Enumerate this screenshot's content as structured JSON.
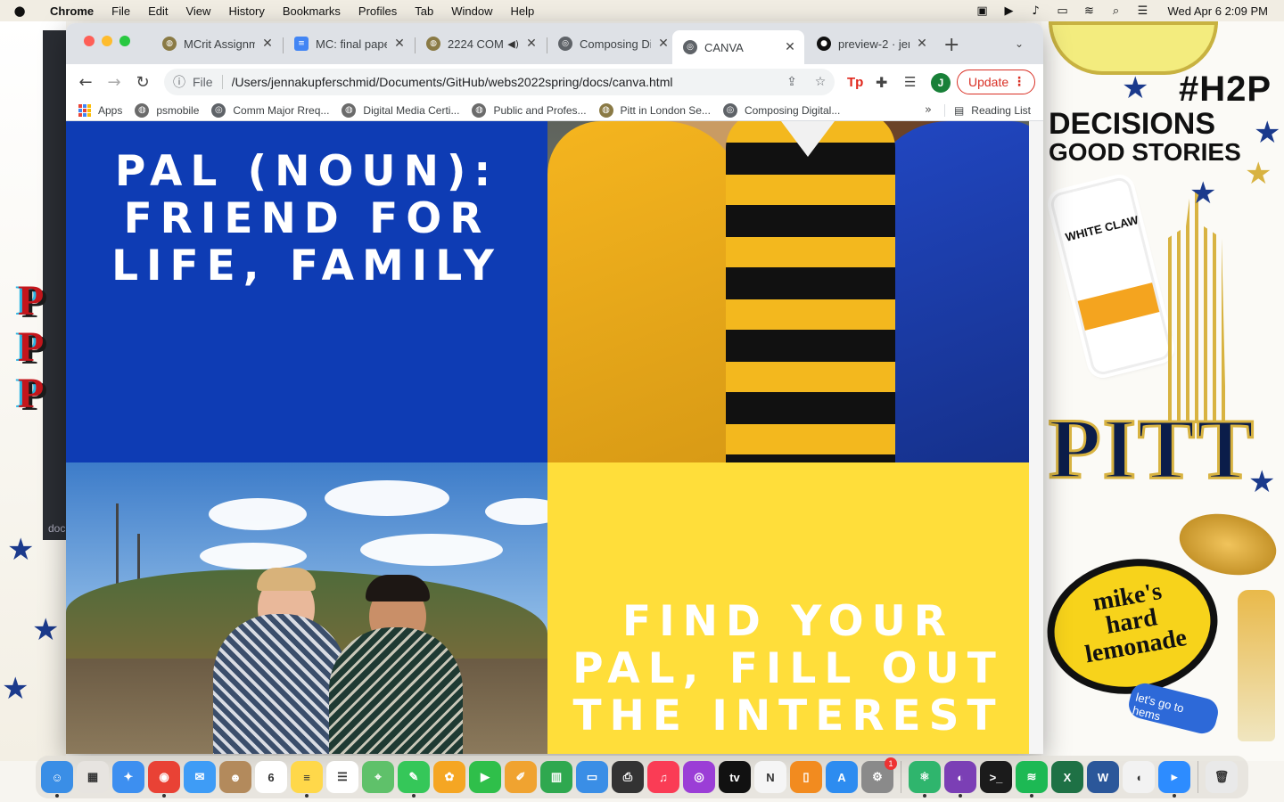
{
  "menubar": {
    "app_name": "Chrome",
    "items": [
      "File",
      "Edit",
      "View",
      "History",
      "Bookmarks",
      "Profiles",
      "Tab",
      "Window",
      "Help"
    ],
    "status_icons": [
      "facetime-icon",
      "play-icon",
      "sound-icon",
      "battery-icon",
      "wifi-icon",
      "spotlight-icon",
      "control-center-icon"
    ],
    "clock": "Wed Apr 6  2:09 PM"
  },
  "browser": {
    "tabs": [
      {
        "title": "MCrit Assignm",
        "favicon": "pitt-seal-icon",
        "color": "#8a7a45"
      },
      {
        "title": "MC: final pape",
        "favicon": "google-docs-icon",
        "color": "#4285f4"
      },
      {
        "title": "2224 COM",
        "favicon": "pitt-seal-icon",
        "color": "#8a7a45"
      },
      {
        "title": "Composing Di",
        "favicon": "globe-icon",
        "color": "#5f6368"
      },
      {
        "title": "CANVA",
        "favicon": "globe-icon",
        "color": "#5f6368"
      },
      {
        "title": "preview-2 · jen",
        "favicon": "github-icon",
        "color": "#111111"
      }
    ],
    "address": {
      "scheme": "File",
      "url": "/Users/jennakupferschmid/Documents/GitHub/webs2022spring/docs/canva.html"
    },
    "profile_initial": "J",
    "update_label": "Update",
    "bookmarks": [
      {
        "label": "Apps"
      },
      {
        "label": "psmobile"
      },
      {
        "label": "Comm Major Rreq..."
      },
      {
        "label": "Digital Media Certi..."
      },
      {
        "label": "Public and Profes..."
      },
      {
        "label": "Pitt in London Se..."
      },
      {
        "label": "Composing Digital..."
      }
    ],
    "reading_list": "Reading List"
  },
  "page": {
    "blue_panel": {
      "line1": "PAL (NOUN):",
      "line2": "FRIEND FOR",
      "line3": "LIFE, FAMILY",
      "color": "#0e3cb4"
    },
    "yellow_panel": {
      "line1": "FIND YOUR",
      "line2": "PAL, FILL OUT",
      "line3": "THE INTEREST",
      "color": "#ffde3a"
    }
  },
  "wallpaper": {
    "sticker_h2p": "#H2P",
    "sticker_decisions": "DECISIONS",
    "sticker_good_stories": "GOOD STORIES",
    "sticker_pitt": "PITT",
    "sticker_white_claw": "WHITE CLAW",
    "sticker_mikes_line1": "mike's",
    "sticker_mikes_line2": "hard",
    "sticker_mikes_line3": "lemonade",
    "sticker_lets_go": "let's go to hems",
    "code_strip_label": "doc"
  },
  "dock": {
    "apps": [
      {
        "name": "finder",
        "color": "#3a8ee6",
        "glyph": "☺"
      },
      {
        "name": "launchpad",
        "color": "#e7e4e0",
        "glyph": "▦"
      },
      {
        "name": "safari",
        "color": "#3d8ff0",
        "glyph": "✦"
      },
      {
        "name": "chrome",
        "color": "#e94235",
        "glyph": "◉"
      },
      {
        "name": "mail",
        "color": "#3e9cf6",
        "glyph": "✉"
      },
      {
        "name": "contacts",
        "color": "#b38a5c",
        "glyph": "☻"
      },
      {
        "name": "calendar",
        "color": "#ffffff",
        "glyph": "6"
      },
      {
        "name": "notes",
        "color": "#ffd84a",
        "glyph": "≡"
      },
      {
        "name": "reminders",
        "color": "#ffffff",
        "glyph": "☰"
      },
      {
        "name": "maps",
        "color": "#5fc16a",
        "glyph": "⌖"
      },
      {
        "name": "messages",
        "color": "#35c759",
        "glyph": "✎"
      },
      {
        "name": "photos",
        "color": "#f5a623",
        "glyph": "✿"
      },
      {
        "name": "facetime",
        "color": "#2fbf4a",
        "glyph": "▶"
      },
      {
        "name": "pages",
        "color": "#f0a330",
        "glyph": "✐"
      },
      {
        "name": "numbers",
        "color": "#2fa84f",
        "glyph": "▥"
      },
      {
        "name": "keynote",
        "color": "#3a8ee6",
        "glyph": "▭"
      },
      {
        "name": "printer",
        "color": "#333333",
        "glyph": "⎙"
      },
      {
        "name": "music",
        "color": "#fa3c55",
        "glyph": "♫"
      },
      {
        "name": "podcasts",
        "color": "#9b3ed6",
        "glyph": "◎"
      },
      {
        "name": "apple-tv",
        "color": "#111111",
        "glyph": "tv"
      },
      {
        "name": "news",
        "color": "#f5f5f5",
        "glyph": "N"
      },
      {
        "name": "books",
        "color": "#f28b1f",
        "glyph": "▯"
      },
      {
        "name": "app-store",
        "color": "#2d8cf0",
        "glyph": "A"
      },
      {
        "name": "system-preferences",
        "color": "#8a8a8a",
        "glyph": "⚙",
        "badge": "1"
      },
      {
        "name": "atom",
        "color": "#2fb56d",
        "glyph": "⚛"
      },
      {
        "name": "github-desktop",
        "color": "#7b3fb5",
        "glyph": "◐"
      },
      {
        "name": "terminal",
        "color": "#1b1b1b",
        "glyph": ">_"
      },
      {
        "name": "spotify",
        "color": "#1db954",
        "glyph": "≋"
      },
      {
        "name": "excel",
        "color": "#1e7145",
        "glyph": "X"
      },
      {
        "name": "word",
        "color": "#2b579a",
        "glyph": "W"
      },
      {
        "name": "audacity",
        "color": "#f2f2f2",
        "glyph": "◖"
      },
      {
        "name": "zoom",
        "color": "#2d8cff",
        "glyph": "▸"
      },
      {
        "name": "trash",
        "color": "#e9e9e9",
        "glyph": "🗑"
      }
    ]
  }
}
